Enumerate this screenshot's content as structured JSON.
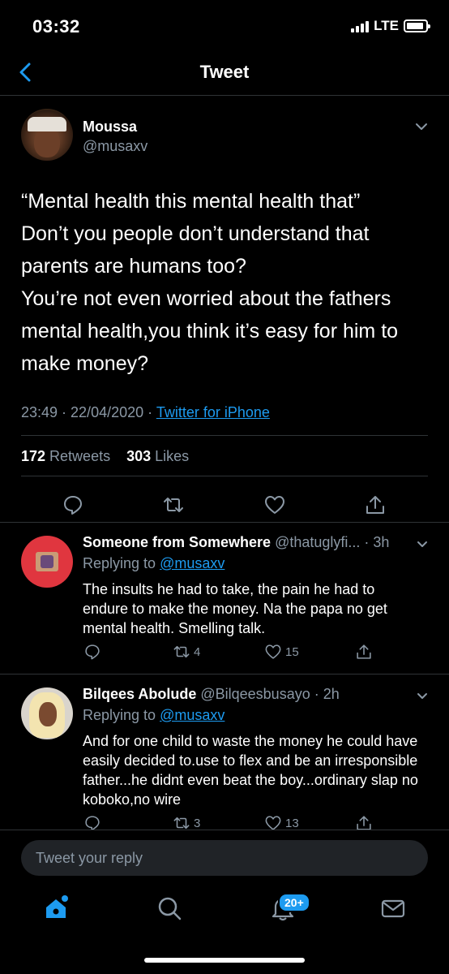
{
  "status_bar": {
    "time": "03:32",
    "network": "LTE",
    "battery_level": 0.9
  },
  "nav": {
    "title": "Tweet"
  },
  "main_tweet": {
    "name": "Moussa",
    "handle": "@musaxv",
    "text": "“Mental health this mental health that”\nDon’t you people don’t understand that parents are humans too?\nYou’re not even worried about the fathers mental health,you think it’s easy for him to make money?",
    "time": "23:49 · 22/04/2020 · ",
    "source": "Twitter for iPhone",
    "retweets": "172",
    "retweets_label": " Retweets",
    "likes": "303",
    "likes_label": " Likes"
  },
  "replies": [
    {
      "name": "Someone from Somewhere",
      "handle": " @thatuglyfi... · 3h",
      "replying_prefix": "Replying to ",
      "replying_to": "@musaxv",
      "text": "The insults he had to take, the pain he had to endure to make the money. Na the papa no get mental health. Smelling talk.",
      "retweets": "4",
      "likes": "15"
    },
    {
      "name": "Bilqees Abolude",
      "handle": " @Bilqeesbusayo · 2h",
      "replying_prefix": "Replying to ",
      "replying_to": "@musaxv",
      "text": "And for one child to waste the money he could have easily decided to.use to flex and be an irresponsible father...he didnt even beat the boy...ordinary slap no koboko,no wire",
      "retweets": "3",
      "likes": "13"
    }
  ],
  "compose": {
    "placeholder": "Tweet your reply"
  },
  "tabbar": {
    "notifications_badge": "20+"
  },
  "colors": {
    "accent": "#1d9bf0",
    "secondary_text": "#8b98a5",
    "divider": "#2f3336",
    "background": "#000000"
  },
  "icons": [
    "back-chevron-icon",
    "chevron-down-icon",
    "reply-icon",
    "retweet-icon",
    "like-icon",
    "share-icon",
    "home-icon",
    "search-icon",
    "notifications-icon",
    "messages-icon"
  ]
}
